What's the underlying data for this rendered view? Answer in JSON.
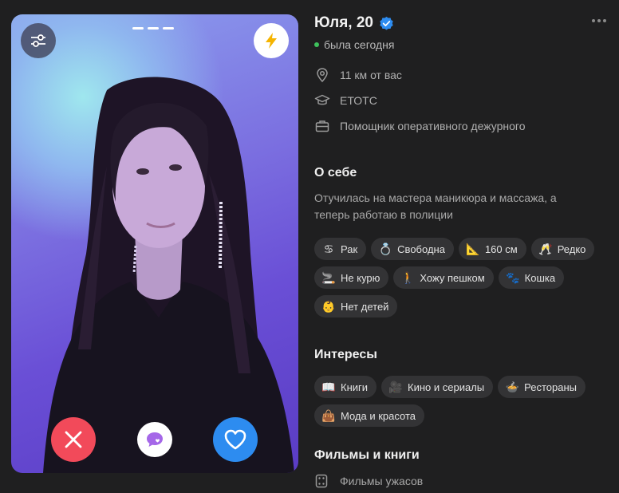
{
  "profile": {
    "name_age": "Юля, 20",
    "status": "была сегодня",
    "distance": "11 км от вас",
    "education": "ЕТОТС",
    "job": "Помощник оперативного дежурного"
  },
  "about": {
    "title": "О себе",
    "text": "Отучилась на мастера маникюра и массажа, а теперь работаю в полиции"
  },
  "traits": [
    {
      "icon": "zodiac-cancer-icon",
      "glyph": "♋",
      "label": "Рак"
    },
    {
      "icon": "ring-icon",
      "glyph": "💍",
      "label": "Свободна"
    },
    {
      "icon": "ruler-icon",
      "glyph": "📐",
      "label": "160 см"
    },
    {
      "icon": "champagne-icon",
      "glyph": "🥂",
      "label": "Редко"
    },
    {
      "icon": "cigarette-icon",
      "glyph": "🚬",
      "label": "Не курю"
    },
    {
      "icon": "walking-icon",
      "glyph": "🚶",
      "label": "Хожу пешком"
    },
    {
      "icon": "paw-icon",
      "glyph": "🐾",
      "label": "Кошка"
    },
    {
      "icon": "baby-icon",
      "glyph": "👶",
      "label": "Нет детей"
    }
  ],
  "interests": {
    "title": "Интересы",
    "items": [
      {
        "icon": "book-icon",
        "glyph": "📖",
        "label": "Книги"
      },
      {
        "icon": "film-camera-icon",
        "glyph": "🎥",
        "label": "Кино и сериалы"
      },
      {
        "icon": "restaurant-icon",
        "glyph": "🍲",
        "label": "Рестораны"
      },
      {
        "icon": "handbag-icon",
        "glyph": "👜",
        "label": "Мода и красота"
      }
    ]
  },
  "films": {
    "title": "Фильмы и книги",
    "item": "Фильмы ужасов"
  },
  "colors": {
    "background": "#1f1f20",
    "chip": "#333335",
    "online": "#3ec15c",
    "dislike": "#f24a5a",
    "like": "#2d8cf0",
    "boost": "#f5b400",
    "chat": "#a567e8"
  }
}
